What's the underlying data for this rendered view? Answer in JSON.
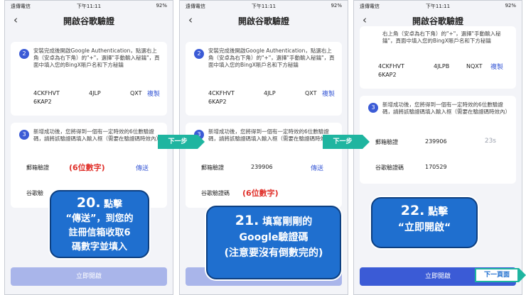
{
  "status": {
    "carrier": "遠傳電信",
    "time": "下午11:11",
    "battery": "92%"
  },
  "screen": {
    "title": "開啟谷歌驗證",
    "back_icon": "chevron-left-icon"
  },
  "step2": {
    "number": "2",
    "text": "安裝完成後開啟Google Authentication，點選右上角（安卓為右下角）的\"+\"，選擇\"手動輸入秘鑰\"，頁面中填入您的BingX賬戶名和下方秘鑰",
    "text_tail": "右上角（安卓為右下角）的\"+\"，選擇\"手動輸入秘鑰\"，頁面中填入您的BingX賬戶名和下方秘鑰",
    "key_a": "4CKFHVT",
    "key_b": "4JLP",
    "key_b_alt": "4JLPB",
    "key_c": "QXT",
    "key_c_alt": "NQXT",
    "key_line2": "6KAP2",
    "copy_label": "複製"
  },
  "step3": {
    "number": "3",
    "text": "新增成功後，您將得到一個有一定時效的6位數驗證碼，請將該驗證碼填入輸入框（需要在驗證碼時效內）"
  },
  "fields": {
    "email_label": "郵箱驗證",
    "email_placeholder": "(6位數字)",
    "send_label": "傳送",
    "email_value": "239906",
    "timer": "23s",
    "google_label": "谷歌驗證碼",
    "google_label_short": "谷歌驗",
    "google_placeholder": "(6位數字)",
    "google_value": "170529"
  },
  "enable_button": "立即開啟",
  "callouts": {
    "c1_num": "20.",
    "c1_head": "點擊",
    "c1_line2": "“傳送”，到您的",
    "c1_line3": "註冊信箱收取6",
    "c1_line4": "碼數字並填入",
    "c2_num": "21.",
    "c2_head": "填寫剛剛的",
    "c2_line2": "Google驗證碼",
    "c2_line3": "(注意要沒有倒數完的)",
    "c3_num": "22.",
    "c3_head": "點擊",
    "c3_line2": "“立即開啟“"
  },
  "arrows": {
    "next_step": "下一步",
    "next_page": "下一頁面"
  },
  "colors": {
    "accent": "#3b5bd6",
    "callout": "#1f6fcf",
    "arrow": "#1fb5a0",
    "hint": "#e0302a"
  }
}
